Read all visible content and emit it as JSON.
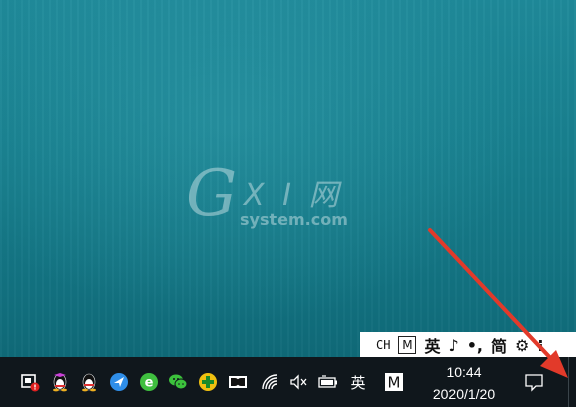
{
  "watermark": {
    "letter": "G",
    "xi": "X I 网",
    "site": "system.com"
  },
  "ime_bar": {
    "mode": "CH",
    "m_label": "M",
    "lang": "英",
    "moon": "♪",
    "punct": "•,",
    "simplified": "简",
    "skin": "⚙",
    "more": "⁝"
  },
  "taskbar": {
    "tray_icons": [
      "security-alert-icon",
      "qq-icon",
      "qq-icon",
      "feishu-icon",
      "browser-e-icon",
      "wechat-icon",
      "360-icon",
      "dolby-icon"
    ],
    "wifi": "wifi-icon",
    "volume": "volume-muted-icon",
    "battery": "battery-icon",
    "ime_lang": "英",
    "m_label": "M",
    "time": "10:44",
    "date": "2020/1/20",
    "notification": "notification-icon"
  },
  "colors": {
    "desktop": "#18808f",
    "taskbar": "#10171c",
    "arrow": "#e23a2a"
  }
}
